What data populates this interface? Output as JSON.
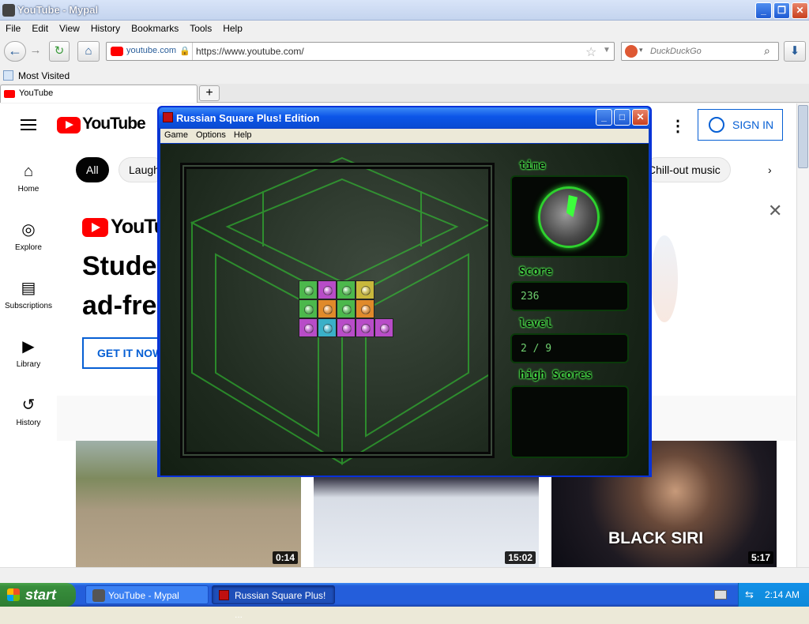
{
  "browser": {
    "title": "YouTube - Mypal",
    "menu": [
      "File",
      "Edit",
      "View",
      "History",
      "Bookmarks",
      "Tools",
      "Help"
    ],
    "site_identity": "youtube.com",
    "url": "https://www.youtube.com/",
    "search_engine": "DuckDuckGo",
    "bookmark": "Most Visited",
    "tab_title": "YouTube",
    "new_tab_icon": "+"
  },
  "youtube": {
    "logo_text": "YouTube",
    "sign_in": "SIGN IN",
    "sidebar": [
      {
        "label": "Home",
        "icon": "home-icon"
      },
      {
        "label": "Explore",
        "icon": "compass-icon"
      },
      {
        "label": "Subscriptions",
        "icon": "subscriptions-icon"
      },
      {
        "label": "Library",
        "icon": "library-icon"
      },
      {
        "label": "History",
        "icon": "history-icon"
      }
    ],
    "chips": [
      "All",
      "Laugh",
      "Chill-out music"
    ],
    "promo": {
      "logo_text": "YouTube",
      "headline_1": "Studer",
      "headline_2": "ad-fre",
      "cta": "GET IT NOW"
    },
    "videos": [
      {
        "duration": "0:14"
      },
      {
        "duration": "15:02"
      },
      {
        "duration": "5:17",
        "overlay_text": "BLACK SIRI"
      }
    ],
    "brand_red": "#ff0000",
    "accent_blue": "#065fd4"
  },
  "game": {
    "title": "Russian Square Plus! Edition",
    "menu": [
      "Game",
      "Options",
      "Help"
    ],
    "time_label": "time",
    "score_label": "Score",
    "score": "236",
    "level_label": "level",
    "level": "2 / 9",
    "high_scores_label": "high Scores",
    "glow_color": "#3cff3c"
  },
  "taskbar": {
    "start": "start",
    "buttons": [
      "YouTube - Mypal",
      "Russian Square Plus! ..."
    ],
    "clock": "2:14 AM"
  }
}
